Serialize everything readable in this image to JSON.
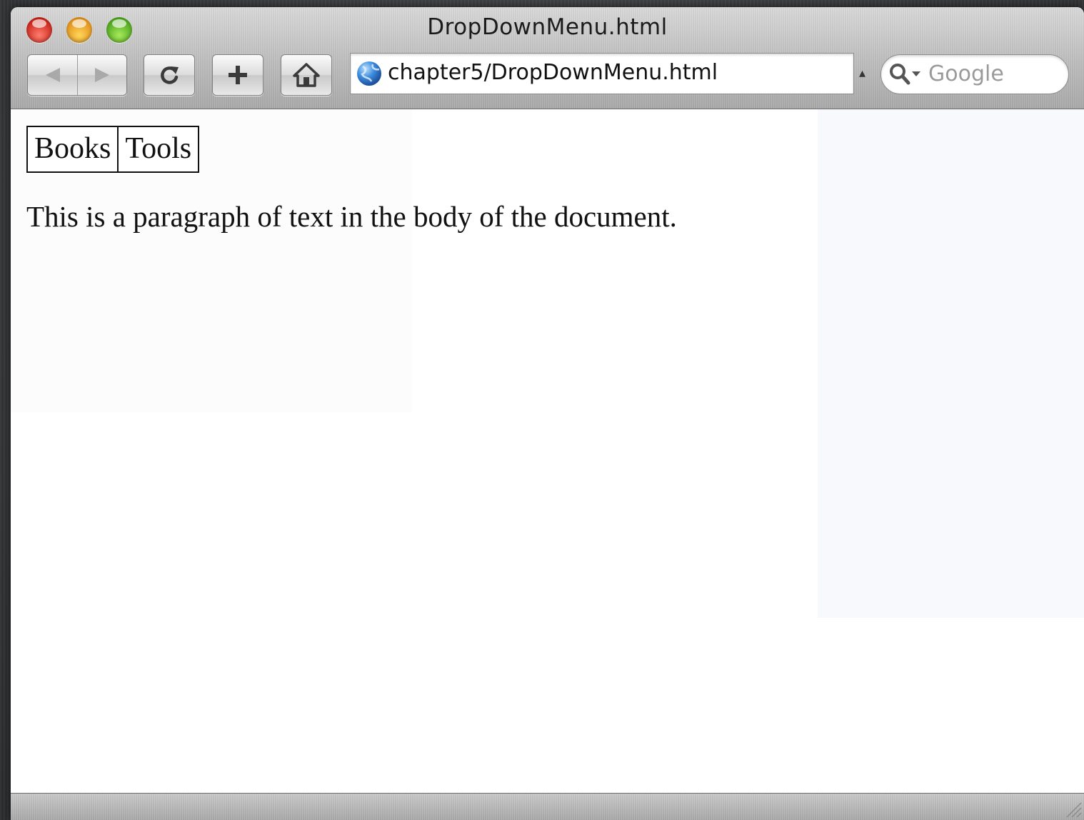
{
  "window": {
    "title": "DropDownMenu.html"
  },
  "toolbar": {
    "back_icon": "back-arrow-icon",
    "forward_icon": "forward-arrow-icon",
    "reload_icon": "reload-icon",
    "add_icon": "plus-icon",
    "home_icon": "home-icon"
  },
  "address_bar": {
    "url": "chapter5/DropDownMenu.html",
    "site_icon": "globe-icon"
  },
  "search": {
    "placeholder": "Google",
    "value": ""
  },
  "page": {
    "menu_items": [
      {
        "label": "Books"
      },
      {
        "label": "Tools"
      }
    ],
    "paragraph": "This is a paragraph of text in the body of the document."
  },
  "colors": {
    "traffic_close": "#e0392b",
    "traffic_minimize": "#f1a72a",
    "traffic_zoom": "#6cc235"
  }
}
